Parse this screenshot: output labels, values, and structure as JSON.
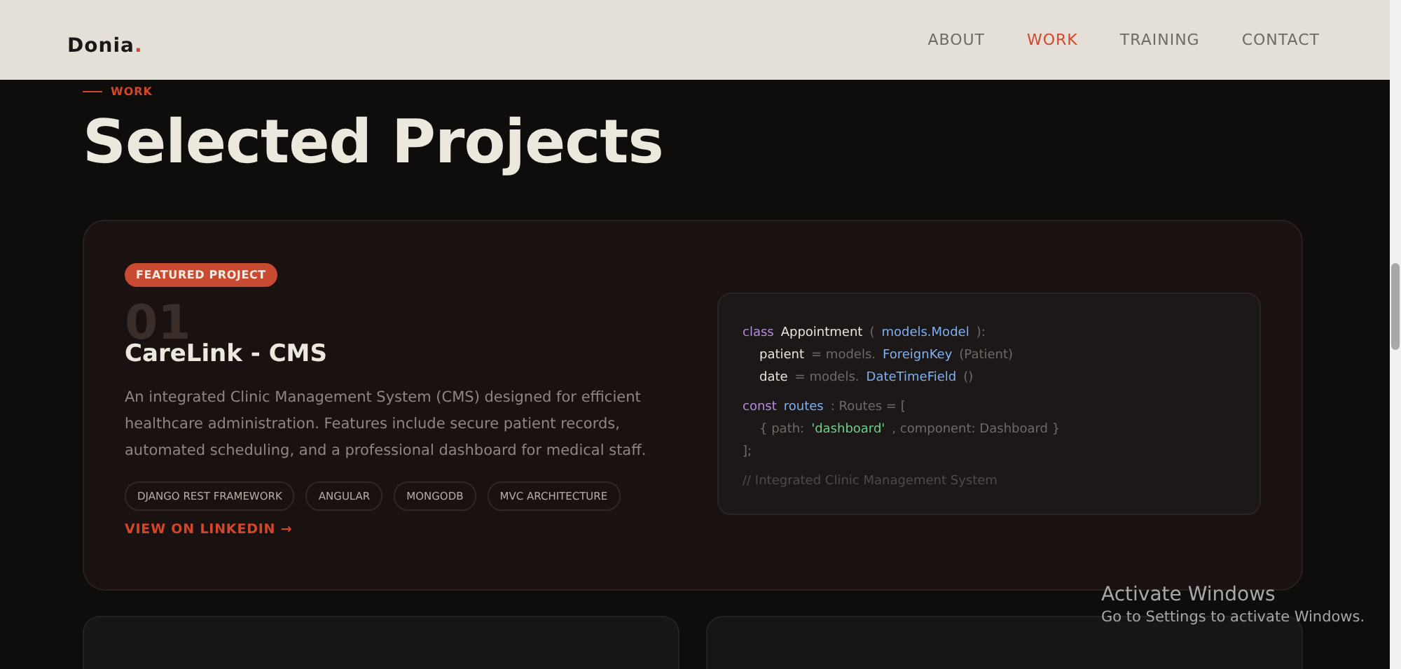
{
  "header": {
    "logo": {
      "text": "Donia",
      "mark": "."
    },
    "nav": [
      {
        "label": "ABOUT",
        "selected": false
      },
      {
        "label": "WORK",
        "selected": true
      },
      {
        "label": "TRAINING",
        "selected": false
      },
      {
        "label": "CONTACT",
        "selected": false
      }
    ]
  },
  "section": {
    "eyebrow": "WORK",
    "title": "Selected Projects"
  },
  "featured": {
    "badge": "FEATURED PROJECT",
    "number": "01",
    "title": "CareLink - CMS",
    "description": "An integrated Clinic Management System (CMS) designed for efficient healthcare administration. Features include secure patient records, automated scheduling, and a professional dashboard for medical staff.",
    "tags": [
      "DJANGO REST FRAMEWORK",
      "ANGULAR",
      "MONGODB",
      "MVC ARCHITECTURE"
    ],
    "link": "VIEW ON LINKEDIN →",
    "code_blocks": [
      [
        {
          "indented": false,
          "tokens": [
            {
              "kind": "keyword",
              "text": "class"
            },
            {
              "kind": "name",
              "text": "Appointment"
            },
            {
              "kind": "plain",
              "text": "("
            },
            {
              "kind": "type",
              "text": "models.Model"
            },
            {
              "kind": "plain",
              "text": "):"
            }
          ]
        },
        {
          "indented": true,
          "tokens": [
            {
              "kind": "name",
              "text": "patient"
            },
            {
              "kind": "plain",
              "text": "= models."
            },
            {
              "kind": "type",
              "text": "ForeignKey"
            },
            {
              "kind": "plain",
              "text": "(Patient)"
            }
          ]
        },
        {
          "indented": true,
          "tokens": [
            {
              "kind": "name",
              "text": "date"
            },
            {
              "kind": "plain",
              "text": "= models."
            },
            {
              "kind": "type",
              "text": "DateTimeField"
            },
            {
              "kind": "plain",
              "text": "()"
            }
          ]
        }
      ],
      [
        {
          "indented": false,
          "tokens": [
            {
              "kind": "keyword",
              "text": "const"
            },
            {
              "kind": "type",
              "text": "routes"
            },
            {
              "kind": "plain",
              "text": ": Routes = ["
            }
          ]
        },
        {
          "indented": true,
          "tokens": [
            {
              "kind": "plain",
              "text": "{ path:"
            },
            {
              "kind": "string",
              "text": "'dashboard'"
            },
            {
              "kind": "plain",
              "text": ", component: Dashboard }"
            }
          ]
        },
        {
          "indented": false,
          "tokens": [
            {
              "kind": "plain",
              "text": "];"
            }
          ]
        }
      ],
      [
        {
          "indented": false,
          "tokens": [
            {
              "kind": "comment",
              "text": "// Integrated Clinic Management System"
            }
          ]
        }
      ]
    ]
  },
  "os_notice": {
    "title": "Activate Windows",
    "text": "Go to Settings to activate Windows."
  }
}
